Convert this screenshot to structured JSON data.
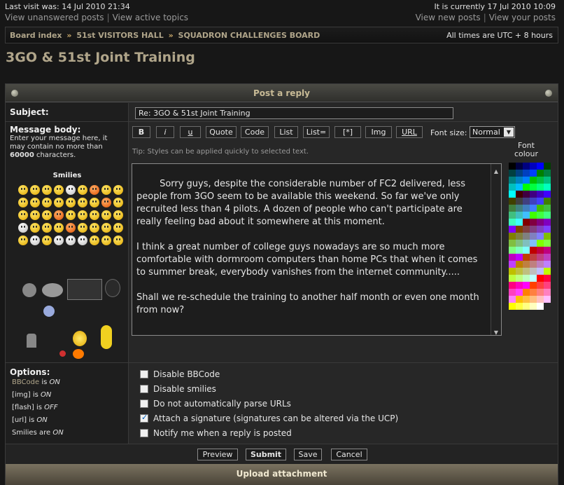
{
  "header": {
    "last_visit": "Last visit was: 14 Jul 2010 21:34",
    "current_time": "It is currently 17 Jul 2010 10:09",
    "links_left": [
      "View unanswered posts",
      "View active topics"
    ],
    "links_right": [
      "View new posts",
      "View your posts"
    ]
  },
  "breadcrumb": {
    "items": [
      "Board index",
      "51st VISITORS HALL",
      "SQUADRON CHALLENGES BOARD"
    ],
    "separator": "»",
    "timezone": "All times are UTC + 8 hours"
  },
  "page_title": "3GO & 51st Joint Training",
  "form": {
    "heading": "Post a reply",
    "subject_label": "Subject:",
    "subject_value": "Re: 3GO & 51st Joint Training",
    "message_label": "Message body:",
    "message_help_pre": "Enter your message here, it may contain no more than ",
    "message_help_limit": "60000",
    "message_help_post": " characters.",
    "smilies_title": "Smilies",
    "toolbar": {
      "bold": "B",
      "italic": "i",
      "underline": "u",
      "quote": "Quote",
      "code": "Code",
      "list": "List",
      "list_ordered": "List=",
      "list_item": "[*]",
      "img": "Img",
      "url": "URL",
      "font_size_label": "Font size:",
      "font_size_value": "Normal"
    },
    "tip": "Tip: Styles can be applied quickly to selected text.",
    "message_body": "Sorry guys, despite the considerable number of FC2 delivered, less people from 3GO seem to be available this weekend. So far we've only recruited less than 4 pilots. A dozen of people who can't participate are really feeling bad about it somewhere at this moment.\n\nI think a great number of college guys nowadays are so much more comfortable with dormroom computers than home PCs that when it comes to summer break, everybody vanishes from the internet community.....\n\nShall we re-schedule the training to another half month or even one month from now?",
    "font_colour_label": "Font colour",
    "options": {
      "title": "Options:",
      "bbcode_key": "BBCode",
      "bbcode_is": " is ",
      "bbcode_state": "ON",
      "img_key": "[img]",
      "img_is": " is ",
      "img_state": "ON",
      "flash_key": "[flash]",
      "flash_is": " is ",
      "flash_state": "OFF",
      "url_key": "[url]",
      "url_is": " is ",
      "url_state": "ON",
      "smilies_key": "Smilies",
      "smilies_is": " are ",
      "smilies_state": "ON"
    },
    "checkboxes": [
      {
        "label": "Disable BBCode",
        "checked": false
      },
      {
        "label": "Disable smilies",
        "checked": false
      },
      {
        "label": "Do not automatically parse URLs",
        "checked": false
      },
      {
        "label": "Attach a signature (signatures can be altered via the UCP)",
        "checked": true
      },
      {
        "label": "Notify me when a reply is posted",
        "checked": false
      }
    ],
    "buttons": {
      "preview": "Preview",
      "submit": "Submit",
      "save": "Save",
      "cancel": "Cancel"
    },
    "upload_label": "Upload attachment"
  },
  "colors": {
    "accent": "#b0a58a",
    "background": "#171717"
  }
}
